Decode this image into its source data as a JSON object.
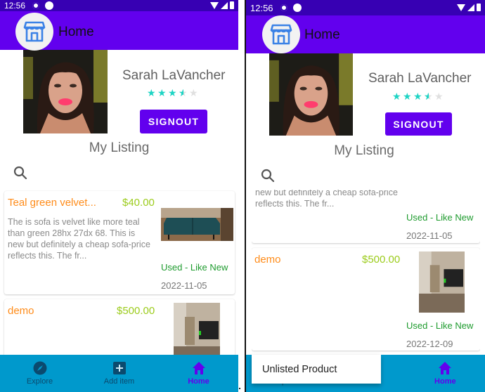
{
  "status_bar": {
    "time": "12:56",
    "icons": [
      "gear-icon",
      "circle-notification-icon",
      "wifi-icon",
      "signal-icon",
      "battery-icon"
    ]
  },
  "app_bar": {
    "title": "Home",
    "logo_icon": "storefront-icon"
  },
  "profile": {
    "name": "Sarah LaVancher",
    "rating": 3.5,
    "rating_max": 5,
    "signout_label": "SIGNOUT"
  },
  "section": {
    "title": "My Listing",
    "search_icon": "search-icon"
  },
  "listings": [
    {
      "title": "Teal green velvet...",
      "price": "$40.00",
      "description": "The is sofa is velvet like more teal than green 28hx 27dx 68. This is new but definitely a cheap sofa-price reflects this. The fr...",
      "condition": "Used - Like New",
      "date": "2022-11-05",
      "image": "teal-sofa-photo"
    },
    {
      "title": "demo",
      "price": "$500.00",
      "description": "",
      "condition": "Used - Like New",
      "date": "2022-12-09",
      "image": "living-room-tv-photo"
    }
  ],
  "bottom_nav": {
    "items": [
      {
        "label": "Explore",
        "icon": "compass-icon",
        "active": false
      },
      {
        "label": "Add item",
        "icon": "add-box-icon",
        "active": false
      },
      {
        "label": "Home",
        "icon": "home-icon",
        "active": true
      }
    ]
  },
  "popup": {
    "label": "Unlisted Product"
  },
  "colors": {
    "status_bar": "#3700b3",
    "primary": "#6200ee",
    "accent_star": "#1dd4c4",
    "title_orange": "#ff8c1a",
    "price_green": "#9ccc1c",
    "condition_green": "#1e9b2e",
    "bottom_nav": "#0099cc"
  }
}
